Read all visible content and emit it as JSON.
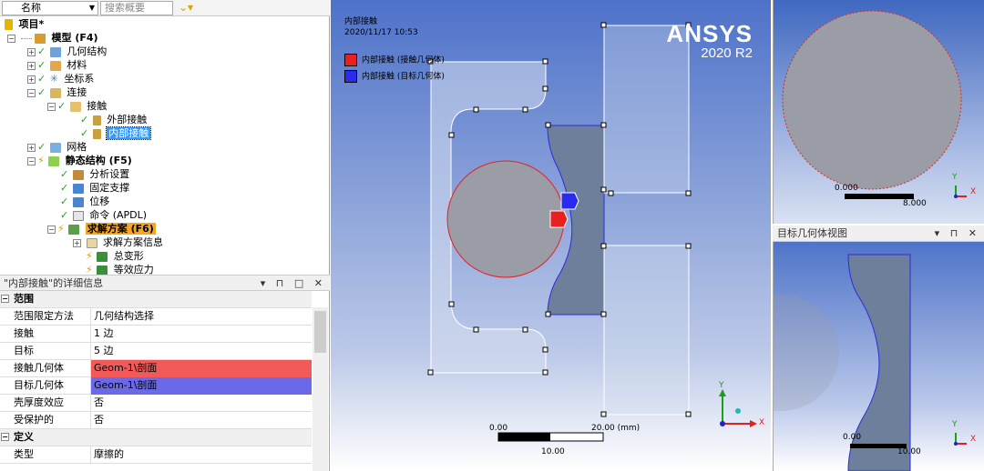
{
  "toolbar": {
    "name_label": "名称",
    "search_placeholder": "搜索概要"
  },
  "tree": {
    "project": "项目*",
    "model": "模型 (F4)",
    "geometry": "几何结构",
    "materials": "材料",
    "coord": "坐标系",
    "connections": "连接",
    "contacts": "接触",
    "outer_contact": "外部接触",
    "inner_contact": "内部接触",
    "mesh": "网格",
    "static": "静态结构 (F5)",
    "analysis_settings": "分析设置",
    "fixed_support": "固定支撑",
    "displacement": "位移",
    "command": "命令 (APDL)",
    "solution": "求解方案 (F6)",
    "solution_info": "求解方案信息",
    "total_deformation": "总变形",
    "equiv_stress": "等效应力"
  },
  "details": {
    "title": "\"内部接触\"的详细信息",
    "scope_section": "范围",
    "scoping_method_k": "范围限定方法",
    "scoping_method_v": "几何结构选择",
    "contact_k": "接触",
    "contact_v": "1 边",
    "target_k": "目标",
    "target_v": "5 边",
    "contact_body_k": "接触几何体",
    "contact_body_v": "Geom-1\\剖面",
    "target_body_k": "目标几何体",
    "target_body_v": "Geom-1\\剖面",
    "shell_k": "壳厚度效应",
    "shell_v": "否",
    "protected_k": "受保护的",
    "protected_v": "否",
    "def_section": "定义",
    "type_k": "类型",
    "type_v": "摩擦的",
    "contact_color": "#f25a5a",
    "target_color": "#6a6ae8"
  },
  "viewport": {
    "title": "内部接触",
    "date": "2020/11/17 10:53",
    "legend_contact": "内部接触 (接触几何体)",
    "legend_target": "内部接触 (目标几何体)",
    "brand": "ANSYS",
    "version": "2020 R2",
    "scale_left": "0.00",
    "scale_right": "20.00 (mm)",
    "scale_mid": "10.00",
    "axis_x": "X",
    "axis_y": "Y"
  },
  "top_right": {
    "scale_left": "0.000",
    "scale_right": "8.000",
    "axis_x": "X",
    "axis_y": "Y"
  },
  "bottom_right": {
    "title": "目标几何体视图",
    "scale_left": "0.00",
    "scale_right": "10.00",
    "axis_x": "X",
    "axis_y": "Y"
  }
}
